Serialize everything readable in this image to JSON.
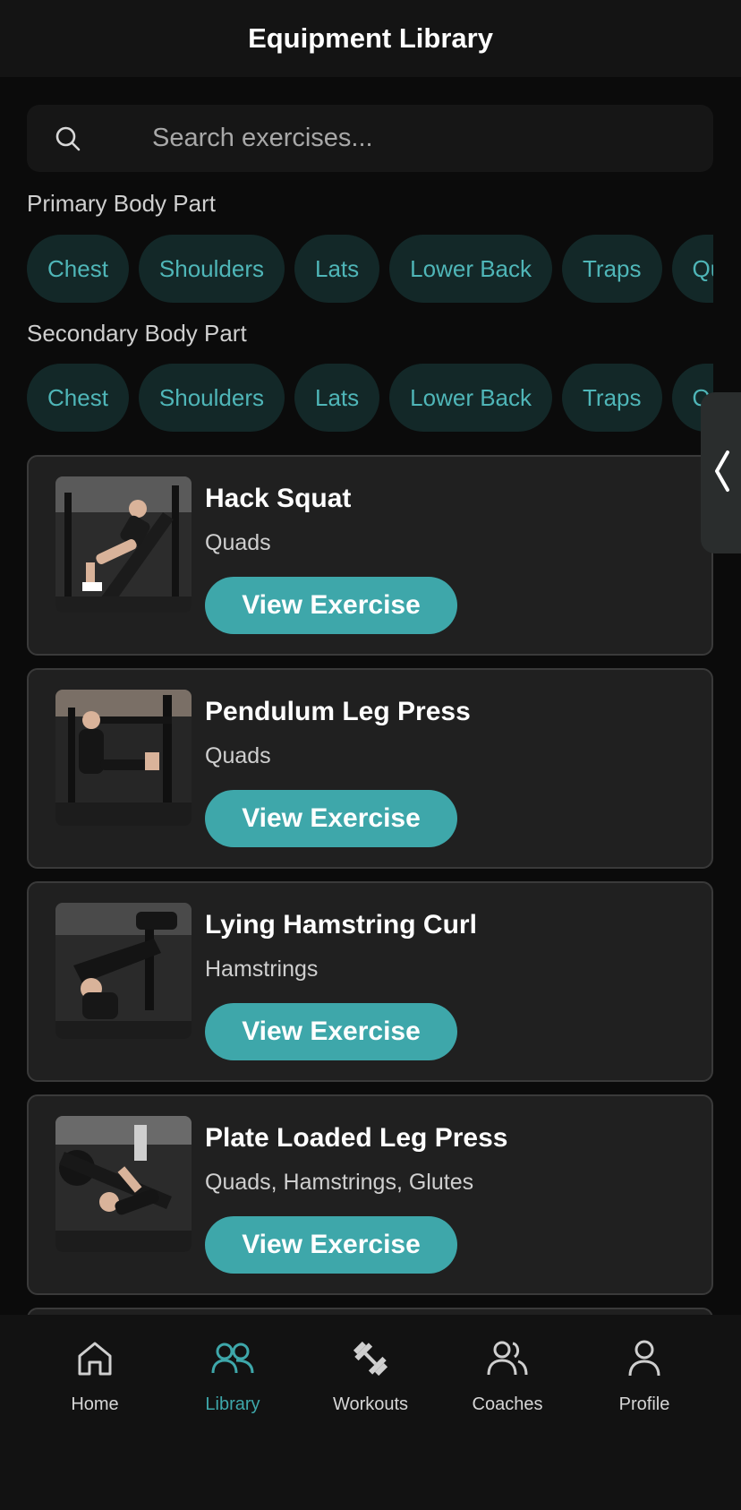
{
  "header": {
    "title": "Equipment Library"
  },
  "search": {
    "placeholder": "Search exercises...",
    "value": ""
  },
  "filters": {
    "primary": {
      "label": "Primary Body Part",
      "chips": [
        "Chest",
        "Shoulders",
        "Lats",
        "Lower Back",
        "Traps",
        "Quads"
      ]
    },
    "secondary": {
      "label": "Secondary Body Part",
      "chips": [
        "Chest",
        "Shoulders",
        "Lats",
        "Lower Back",
        "Traps",
        "Quads"
      ]
    }
  },
  "exercises": [
    {
      "title": "Hack Squat",
      "muscles": "Quads",
      "button": "View Exercise"
    },
    {
      "title": "Pendulum Leg Press",
      "muscles": "Quads",
      "button": "View Exercise"
    },
    {
      "title": "Lying Hamstring Curl",
      "muscles": "Hamstrings",
      "button": "View Exercise"
    },
    {
      "title": "Plate Loaded Leg Press",
      "muscles": "Quads, Hamstrings, Glutes",
      "button": "View Exercise"
    }
  ],
  "nav": {
    "items": [
      {
        "label": "Home",
        "icon": "home-icon"
      },
      {
        "label": "Library",
        "icon": "library-icon",
        "active": true
      },
      {
        "label": "Workouts",
        "icon": "dumbbell-icon"
      },
      {
        "label": "Coaches",
        "icon": "coaches-icon"
      },
      {
        "label": "Profile",
        "icon": "profile-icon"
      }
    ]
  },
  "colors": {
    "accent": "#3ea7aa",
    "chip_bg": "#132828",
    "chip_text": "#4fb6b8",
    "card_bg": "#202020",
    "background": "#0b0b0b"
  }
}
